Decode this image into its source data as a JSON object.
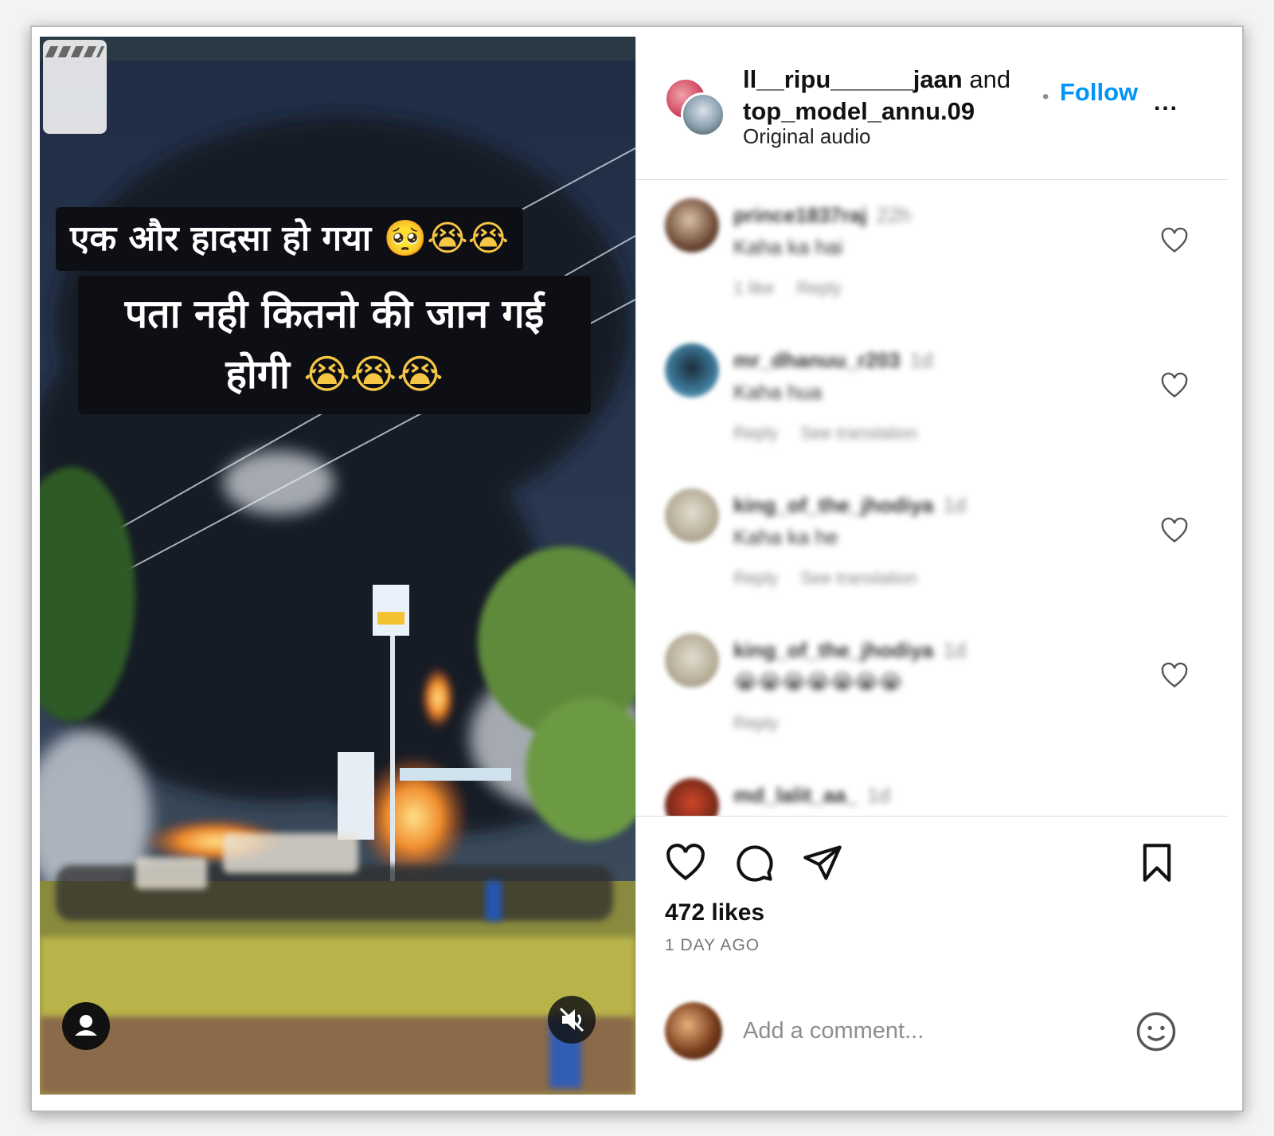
{
  "video": {
    "caption_line1": "एक और हादसा हो गया",
    "caption_line1_emoji": "🥺😭😭",
    "caption_line2": "पता नही कितनो की जान गई होगी",
    "caption_line2_emoji": "😭😭😭"
  },
  "header": {
    "user1": "ll__ripu______jaan",
    "joiner": "and",
    "user2": "top_model_annu.09",
    "audio": "Original audio",
    "follow_label": "Follow",
    "more_label": "..."
  },
  "comments": [
    {
      "user": "prince1837raj",
      "time": "22h",
      "text": "Kaha ka hai",
      "meta": [
        "1 like",
        "Reply"
      ]
    },
    {
      "user": "mr_dhanuu_r203",
      "time": "1d",
      "text": "Kaha hua",
      "meta": [
        "Reply",
        "See translation"
      ]
    },
    {
      "user": "king_of_the_jhodiya",
      "time": "1d",
      "text": "Kaha ka he",
      "meta": [
        "Reply",
        "See translation"
      ]
    },
    {
      "user": "king_of_the_jhodiya",
      "time": "1d",
      "text": "😭😭😭😭😭😭😭",
      "meta": [
        "Reply"
      ]
    },
    {
      "user": "md_lalit_aa_",
      "time": "1d",
      "text": "",
      "meta": []
    }
  ],
  "actions": {
    "likes": "472 likes",
    "posted": "1 DAY AGO"
  },
  "composer": {
    "placeholder": "Add a comment..."
  },
  "icons": {
    "like": "heart-icon",
    "comment": "comment-icon",
    "share": "share-icon",
    "save": "bookmark-icon",
    "emoji": "emoji-icon",
    "mute": "muted-speaker-icon",
    "profile": "user-icon",
    "reel": "reel-icon"
  },
  "colors": {
    "follow": "#0095f6",
    "smoke": "#1c2433"
  }
}
